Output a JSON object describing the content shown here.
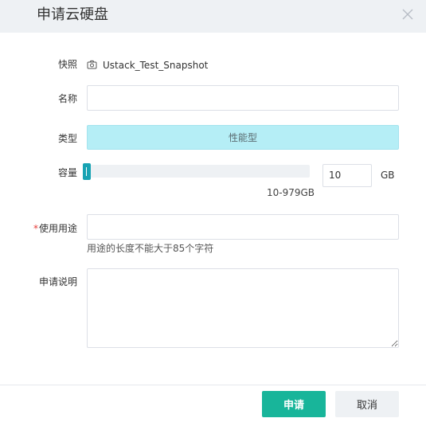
{
  "dialog": {
    "title": "申请云硬盘"
  },
  "form": {
    "snapshot": {
      "label": "快照",
      "value": "Ustack_Test_Snapshot",
      "icon": "camera-icon"
    },
    "name": {
      "label": "名称",
      "value": "",
      "placeholder": ""
    },
    "type": {
      "label": "类型",
      "selected": "性能型"
    },
    "capacity": {
      "label": "容量",
      "value": "10",
      "unit": "GB",
      "range": "10-979GB",
      "min": 10,
      "max": 979
    },
    "usage": {
      "required_mark": "*",
      "label": "使用用途",
      "value": "",
      "hint": "用途的长度不能大于85个字符"
    },
    "description": {
      "label": "申请说明",
      "value": ""
    }
  },
  "footer": {
    "submit_label": "申请",
    "cancel_label": "取消"
  },
  "colors": {
    "accent": "#18b59a",
    "type_selected_bg": "#b5eef6",
    "slider_handle": "#17a3b3",
    "header_bg": "#eef1f4",
    "required": "#e53935"
  }
}
